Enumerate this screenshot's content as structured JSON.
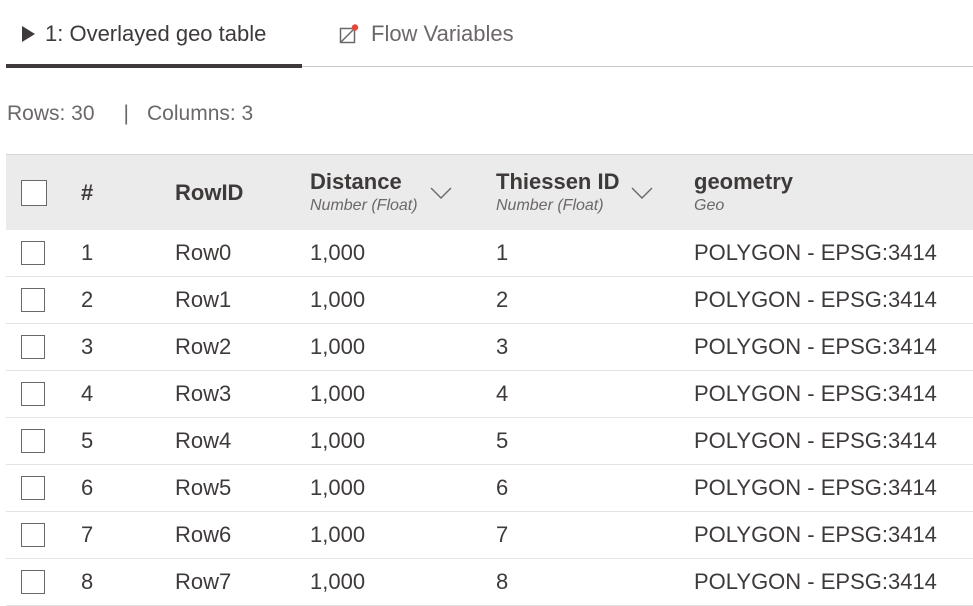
{
  "tabs": [
    {
      "label": "1: Overlayed geo table",
      "icon": "play-icon",
      "active": true
    },
    {
      "label": "Flow Variables",
      "icon": "flow-variable-icon",
      "active": false
    }
  ],
  "stats": {
    "rows": "Rows: 30",
    "separator": "|",
    "columns": "Columns: 3"
  },
  "table": {
    "headers": {
      "number": "#",
      "rowid": "RowID",
      "distance": {
        "name": "Distance",
        "type": "Number (Float)"
      },
      "thiessen": {
        "name": "Thiessen ID",
        "type": "Number (Float)"
      },
      "geometry": {
        "name": "geometry",
        "type": "Geo"
      }
    },
    "rows": [
      {
        "num": "1",
        "rowid": "Row0",
        "distance": "1,000",
        "thiessen": "1",
        "geometry": "POLYGON - EPSG:3414"
      },
      {
        "num": "2",
        "rowid": "Row1",
        "distance": "1,000",
        "thiessen": "2",
        "geometry": "POLYGON - EPSG:3414"
      },
      {
        "num": "3",
        "rowid": "Row2",
        "distance": "1,000",
        "thiessen": "3",
        "geometry": "POLYGON - EPSG:3414"
      },
      {
        "num": "4",
        "rowid": "Row3",
        "distance": "1,000",
        "thiessen": "4",
        "geometry": "POLYGON - EPSG:3414"
      },
      {
        "num": "5",
        "rowid": "Row4",
        "distance": "1,000",
        "thiessen": "5",
        "geometry": "POLYGON - EPSG:3414"
      },
      {
        "num": "6",
        "rowid": "Row5",
        "distance": "1,000",
        "thiessen": "6",
        "geometry": "POLYGON - EPSG:3414"
      },
      {
        "num": "7",
        "rowid": "Row6",
        "distance": "1,000",
        "thiessen": "7",
        "geometry": "POLYGON - EPSG:3414"
      },
      {
        "num": "8",
        "rowid": "Row7",
        "distance": "1,000",
        "thiessen": "8",
        "geometry": "POLYGON - EPSG:3414"
      }
    ]
  },
  "colors": {
    "text": "#3e3a39",
    "muted": "#6b6867",
    "header_bg": "#ebebeb",
    "accent_dot": "#e3483a"
  }
}
